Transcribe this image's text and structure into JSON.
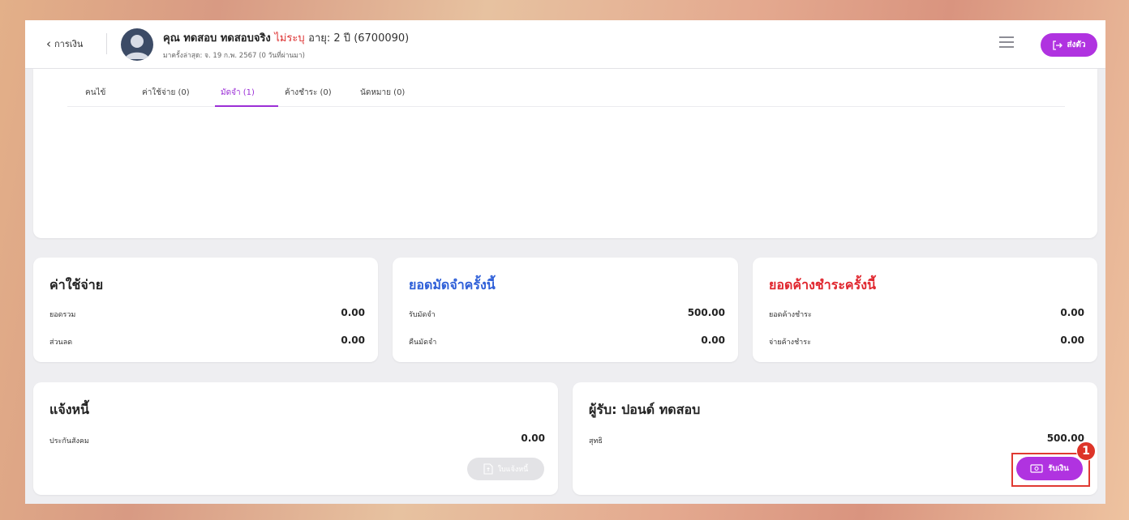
{
  "header": {
    "back_label": "การเงิน",
    "patient_name": "คุณ ทดสอบ ทดสอบจริง",
    "gender": "ไม่ระบุ",
    "age_text": "อายุ: 2 ปี (6700090)",
    "last_visit": "มาครั้งล่าสุด: จ. 19 ก.พ. 2567 (0 วันที่ผ่านมา)",
    "send_button_label": "ส่งตัว"
  },
  "tabs": [
    {
      "label": "คนไข้"
    },
    {
      "label": "ค่าใช้จ่าย (0)"
    },
    {
      "label": "มัดจำ (1)",
      "active": true
    },
    {
      "label": "ค้างชำระ (0)"
    },
    {
      "label": "นัดหมาย (0)"
    }
  ],
  "expenses": {
    "title": "ค่าใช้จ่าย",
    "rows": [
      {
        "label": "ยอดรวม",
        "value": "0.00"
      },
      {
        "label": "ส่วนลด",
        "value": "0.00"
      }
    ]
  },
  "deposit": {
    "title": "ยอดมัดจำครั้งนี้",
    "rows": [
      {
        "label": "รับมัดจำ",
        "value": "500.00"
      },
      {
        "label": "คืนมัดจำ",
        "value": "0.00"
      }
    ]
  },
  "outstanding": {
    "title": "ยอดค้างชำระครั้งนี้",
    "rows": [
      {
        "label": "ยอดค้างชำระ",
        "value": "0.00"
      },
      {
        "label": "จ่ายค้างชำระ",
        "value": "0.00"
      }
    ]
  },
  "invoice": {
    "title": "แจ้งหนี้",
    "rows": [
      {
        "label": "ประกันสังคม",
        "value": "0.00"
      }
    ],
    "button_label": "ใบแจ้งหนี้"
  },
  "receiver": {
    "title": "ผู้รับ: ปอนด์ ทดสอบ",
    "rows": [
      {
        "label": "สุทธิ",
        "value": "500.00"
      }
    ],
    "button_label": "รับเงิน"
  },
  "annotation": {
    "step": "1"
  },
  "colors": {
    "accent": "#b033e0",
    "deposit_title": "#2e5fd8",
    "outstanding_title": "#e0262e",
    "highlight": "#e03a32"
  }
}
